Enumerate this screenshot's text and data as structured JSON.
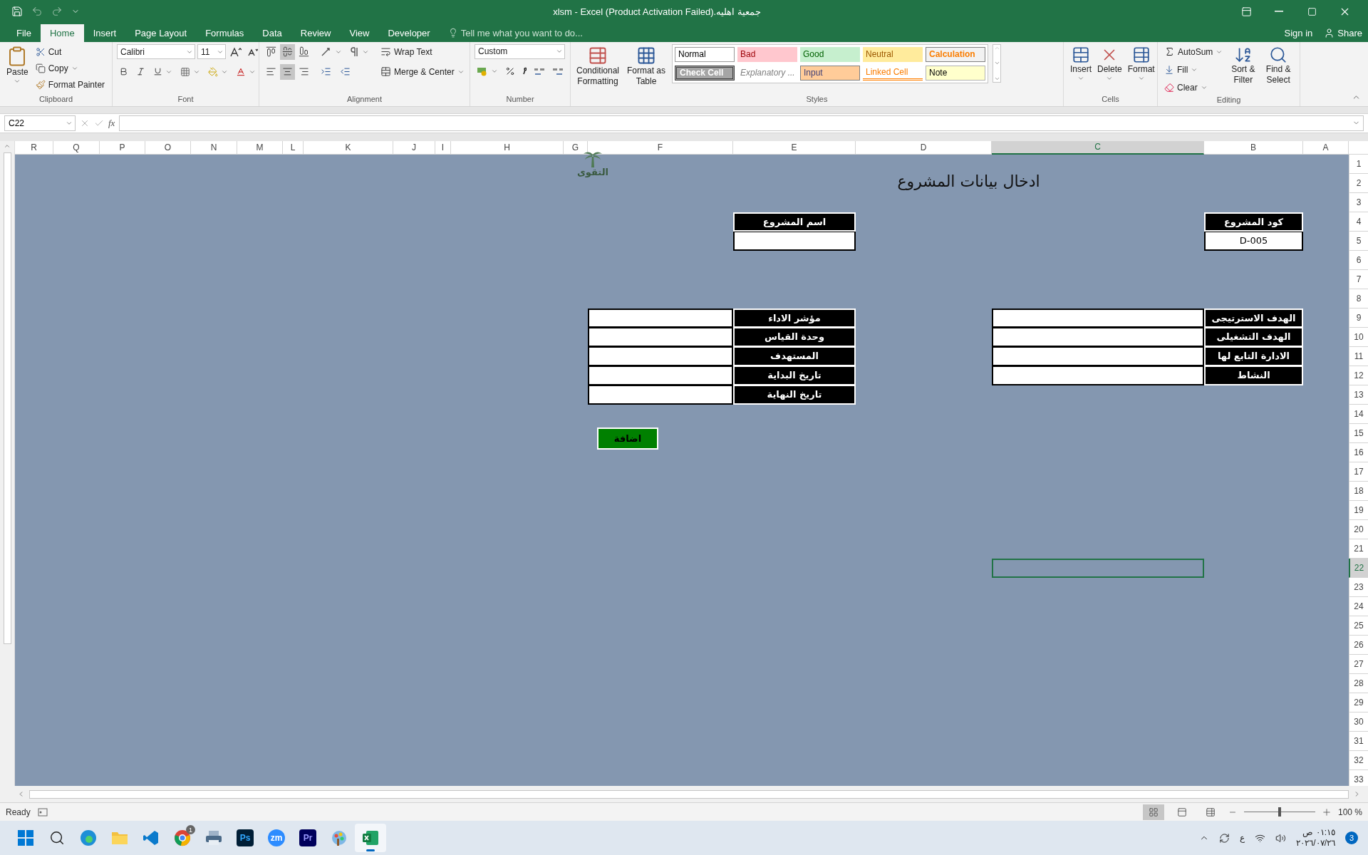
{
  "title_bar": {
    "title": "جمعية اهليه.xlsm - Excel (Product Activation Failed)"
  },
  "tabs": [
    {
      "label": "File",
      "selected": false
    },
    {
      "label": "Home",
      "selected": true
    },
    {
      "label": "Insert",
      "selected": false
    },
    {
      "label": "Page Layout",
      "selected": false
    },
    {
      "label": "Formulas",
      "selected": false
    },
    {
      "label": "Data",
      "selected": false
    },
    {
      "label": "Review",
      "selected": false
    },
    {
      "label": "View",
      "selected": false
    },
    {
      "label": "Developer",
      "selected": false
    }
  ],
  "tell_me": {
    "placeholder": "Tell me what you want to do..."
  },
  "account": {
    "sign_in": "Sign in",
    "share": "Share"
  },
  "ribbon": {
    "clipboard": {
      "label": "Clipboard",
      "paste": "Paste",
      "cut": "Cut",
      "copy": "Copy",
      "format_painter": "Format Painter"
    },
    "font": {
      "label": "Font",
      "font_name": "Calibri",
      "font_size": "11"
    },
    "alignment": {
      "label": "Alignment",
      "wrap_text": "Wrap Text",
      "merge": "Merge & Center",
      "vertical": [
        {
          "selected": false
        },
        {
          "selected": true
        },
        {
          "selected": false
        }
      ],
      "horizontal": [
        {
          "selected": false
        },
        {
          "selected": true
        },
        {
          "selected": false
        }
      ]
    },
    "number": {
      "label": "Number",
      "format": "Custom"
    },
    "styles": {
      "label": "Styles",
      "conditional": "Conditional Formatting",
      "format_table": "Format as Table",
      "gallery": [
        {
          "name": "Normal",
          "kind": "normal"
        },
        {
          "name": "Bad",
          "kind": "bad"
        },
        {
          "name": "Good",
          "kind": "good"
        },
        {
          "name": "Neutral",
          "kind": "neutral"
        },
        {
          "name": "Calculation",
          "kind": "calculation"
        },
        {
          "name": "Check Cell",
          "kind": "check"
        },
        {
          "name": "Explanatory ...",
          "kind": "explanatory"
        },
        {
          "name": "Input",
          "kind": "input"
        },
        {
          "name": "Linked Cell",
          "kind": "linked"
        },
        {
          "name": "Note",
          "kind": "note"
        }
      ]
    },
    "cells": {
      "label": "Cells",
      "buttons": [
        "Insert",
        "Delete",
        "Format"
      ]
    },
    "editing": {
      "label": "Editing",
      "autosum": "AutoSum",
      "fill": "Fill",
      "clear": "Clear",
      "sort": "Sort & Filter",
      "find": "Find & Select"
    }
  },
  "formula_bar": {
    "name_box": "C22",
    "function_label": "fx"
  },
  "columns": [
    {
      "label": "R",
      "selected": false
    },
    {
      "label": "Q",
      "selected": false
    },
    {
      "label": "P",
      "selected": false
    },
    {
      "label": "O",
      "selected": false
    },
    {
      "label": "N",
      "selected": false
    },
    {
      "label": "M",
      "selected": false
    },
    {
      "label": "L",
      "selected": false
    },
    {
      "label": "K",
      "selected": false
    },
    {
      "label": "J",
      "selected": false
    },
    {
      "label": "I",
      "selected": false
    },
    {
      "label": "H",
      "selected": false
    },
    {
      "label": "G",
      "selected": false
    },
    {
      "label": "F",
      "selected": false
    },
    {
      "label": "E",
      "selected": false
    },
    {
      "label": "D",
      "selected": false
    },
    {
      "label": "C",
      "selected": true
    },
    {
      "label": "B",
      "selected": false
    },
    {
      "label": "A",
      "selected": false
    }
  ],
  "rows": [
    {
      "label": "1",
      "selected": false
    },
    {
      "label": "2",
      "selected": false
    },
    {
      "label": "3",
      "selected": false
    },
    {
      "label": "4",
      "selected": false
    },
    {
      "label": "5",
      "selected": false
    },
    {
      "label": "6",
      "selected": false
    },
    {
      "label": "7",
      "selected": false
    },
    {
      "label": "8",
      "selected": false
    },
    {
      "label": "9",
      "selected": false
    },
    {
      "label": "10",
      "selected": false
    },
    {
      "label": "11",
      "selected": false
    },
    {
      "label": "12",
      "selected": false
    },
    {
      "label": "13",
      "selected": false
    },
    {
      "label": "14",
      "selected": false
    },
    {
      "label": "15",
      "selected": false
    },
    {
      "label": "16",
      "selected": false
    },
    {
      "label": "17",
      "selected": false
    },
    {
      "label": "18",
      "selected": false
    },
    {
      "label": "19",
      "selected": false
    },
    {
      "label": "20",
      "selected": false
    },
    {
      "label": "21",
      "selected": false
    },
    {
      "label": "22",
      "selected": true
    },
    {
      "label": "23",
      "selected": false
    },
    {
      "label": "24",
      "selected": false
    },
    {
      "label": "25",
      "selected": false
    },
    {
      "label": "26",
      "selected": false
    },
    {
      "label": "27",
      "selected": false
    },
    {
      "label": "28",
      "selected": false
    },
    {
      "label": "29",
      "selected": false
    },
    {
      "label": "30",
      "selected": false
    },
    {
      "label": "31",
      "selected": false
    },
    {
      "label": "32",
      "selected": false
    },
    {
      "label": "33",
      "selected": false
    }
  ],
  "sheet": {
    "title": "ادخال بيانات المشروع",
    "logo_text": "التقوى",
    "project_code": {
      "label": "كود المشروع",
      "value": "D-005"
    },
    "project_name": {
      "label": "اسم المشروع"
    },
    "goals_form": [
      "الهدف الاسترتيجى",
      "الهدف التشغيلى",
      "الادارة التابع لها",
      "النشاط"
    ],
    "indicator_form": [
      "مؤشر الاداء",
      "وحدة القياس",
      "المستهدف",
      "تاريخ البداية",
      "تاريخ النهاية"
    ],
    "add_button": "اضافة"
  },
  "status_bar": {
    "status": "Ready",
    "views": [
      {
        "kind": "normal",
        "selected": true
      },
      {
        "kind": "layout",
        "selected": false
      },
      {
        "kind": "break",
        "selected": false
      }
    ],
    "zoom": {
      "level": 0.5
    },
    "zoom_label": "100 %"
  },
  "taskbar": {
    "apps": [
      {
        "kind": "windows",
        "selected": false
      },
      {
        "kind": "search",
        "selected": false
      },
      {
        "kind": "edge",
        "selected": false
      },
      {
        "kind": "files",
        "selected": false
      },
      {
        "kind": "vscode",
        "selected": false
      },
      {
        "kind": "chrome",
        "selected": false,
        "badge": "1"
      },
      {
        "kind": "printer",
        "selected": false
      },
      {
        "kind": "ps",
        "label": "Ps",
        "selected": false
      },
      {
        "kind": "zoom",
        "label": "zm",
        "selected": false
      },
      {
        "kind": "pr",
        "label": "Pr",
        "selected": false
      },
      {
        "kind": "paint",
        "selected": false
      },
      {
        "kind": "excel",
        "selected": true
      }
    ],
    "keyboard": "ع",
    "time": "٠١:١٥ ص",
    "date": "٢٠٢٦/٠٧/٢٦",
    "notifications": "3"
  }
}
